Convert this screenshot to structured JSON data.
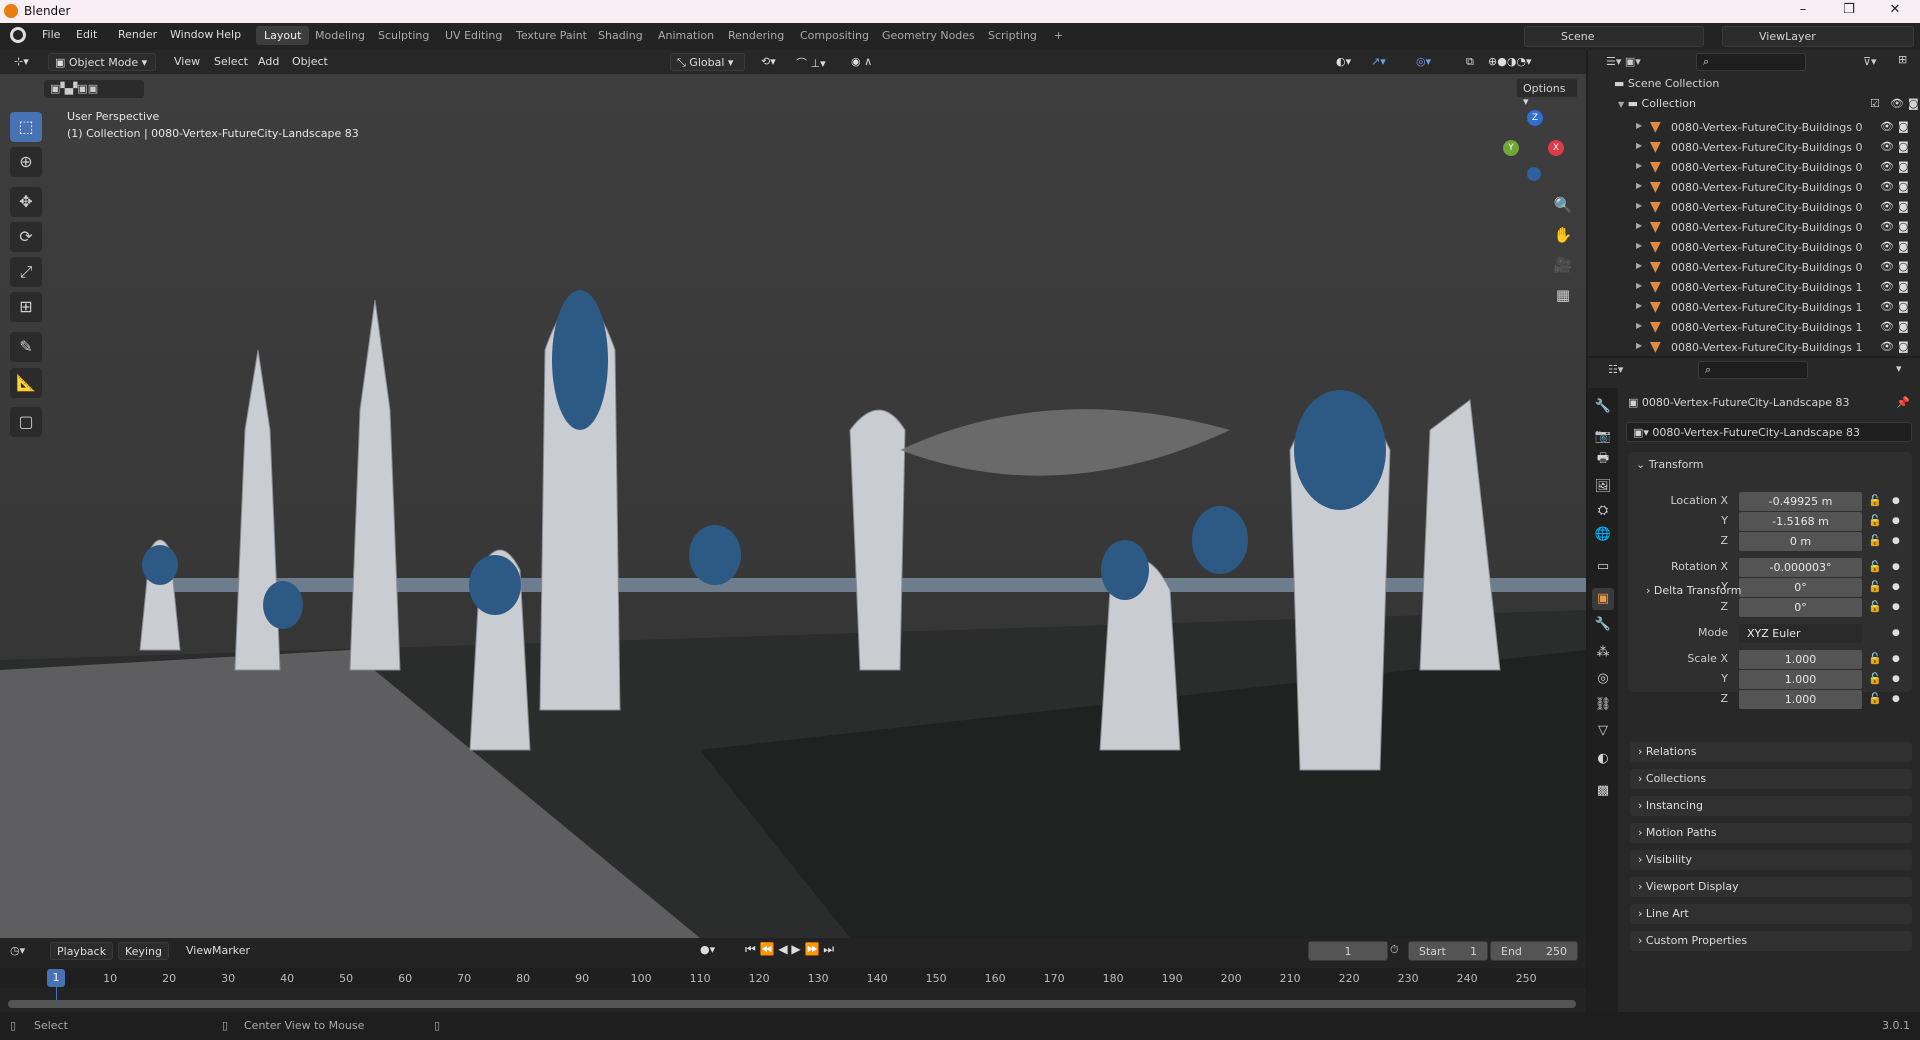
{
  "window": {
    "title": "Blender",
    "min": "–",
    "max": "❐",
    "close": "✕"
  },
  "menu": [
    "File",
    "Edit",
    "Render",
    "Window",
    "Help"
  ],
  "workspaces": [
    "Layout",
    "Modeling",
    "Sculpting",
    "UV Editing",
    "Texture Paint",
    "Shading",
    "Animation",
    "Rendering",
    "Compositing",
    "Geometry Nodes",
    "Scripting",
    "+"
  ],
  "scene": {
    "scene_name": "Scene",
    "view_layer": "ViewLayer"
  },
  "viewport": {
    "mode": "Object Mode",
    "menus": [
      "View",
      "Select",
      "Add",
      "Object"
    ],
    "orientation": "Global",
    "options": "Options",
    "perspective": "User Perspective",
    "collection_info": "(1) Collection | 0080-Vertex-FutureCity-Landscape 83",
    "gizmo": {
      "x": "X",
      "y": "Y",
      "z": "Z"
    }
  },
  "outliner": {
    "scene_collection": "Scene Collection",
    "collection": "Collection",
    "items": [
      "0080-Vertex-FutureCity-Buildings 0",
      "0080-Vertex-FutureCity-Buildings 0",
      "0080-Vertex-FutureCity-Buildings 0",
      "0080-Vertex-FutureCity-Buildings 0",
      "0080-Vertex-FutureCity-Buildings 0",
      "0080-Vertex-FutureCity-Buildings 0",
      "0080-Vertex-FutureCity-Buildings 0",
      "0080-Vertex-FutureCity-Buildings 0",
      "0080-Vertex-FutureCity-Buildings 1",
      "0080-Vertex-FutureCity-Buildings 1",
      "0080-Vertex-FutureCity-Buildings 1",
      "0080-Vertex-FutureCity-Buildings 1"
    ]
  },
  "properties": {
    "object_name": "0080-Vertex-FutureCity-Landscape 83",
    "data_name": "0080-Vertex-FutureCity-Landscape 83",
    "transform_label": "Transform",
    "rows": [
      {
        "label": "Location X",
        "value": "-0.49925 m"
      },
      {
        "label": "Y",
        "value": "-1.5168 m"
      },
      {
        "label": "Z",
        "value": "0 m"
      },
      {
        "label": "Rotation X",
        "value": "-0.000003°"
      },
      {
        "label": "Y",
        "value": "0°"
      },
      {
        "label": "Z",
        "value": "0°"
      },
      {
        "label": "Mode",
        "value": "XYZ Euler"
      },
      {
        "label": "Scale X",
        "value": "1.000"
      },
      {
        "label": "Y",
        "value": "1.000"
      },
      {
        "label": "Z",
        "value": "1.000"
      }
    ],
    "delta": "Delta Transform",
    "panels": [
      "Relations",
      "Collections",
      "Instancing",
      "Motion Paths",
      "Visibility",
      "Viewport Display",
      "Line Art",
      "Custom Properties"
    ]
  },
  "timeline": {
    "menus": [
      "Playback",
      "Keying",
      "View",
      "Marker"
    ],
    "current_frame": "1",
    "start_label": "Start",
    "start": "1",
    "end_label": "End",
    "end": "250",
    "ticks": [
      "10",
      "20",
      "30",
      "40",
      "50",
      "60",
      "70",
      "80",
      "90",
      "100",
      "110",
      "120",
      "130",
      "140",
      "150",
      "160",
      "170",
      "180",
      "190",
      "200",
      "210",
      "220",
      "230",
      "240",
      "250"
    ],
    "playhead": "1"
  },
  "status": {
    "select": "Select",
    "center": "Center View to Mouse",
    "version": "3.0.1"
  }
}
